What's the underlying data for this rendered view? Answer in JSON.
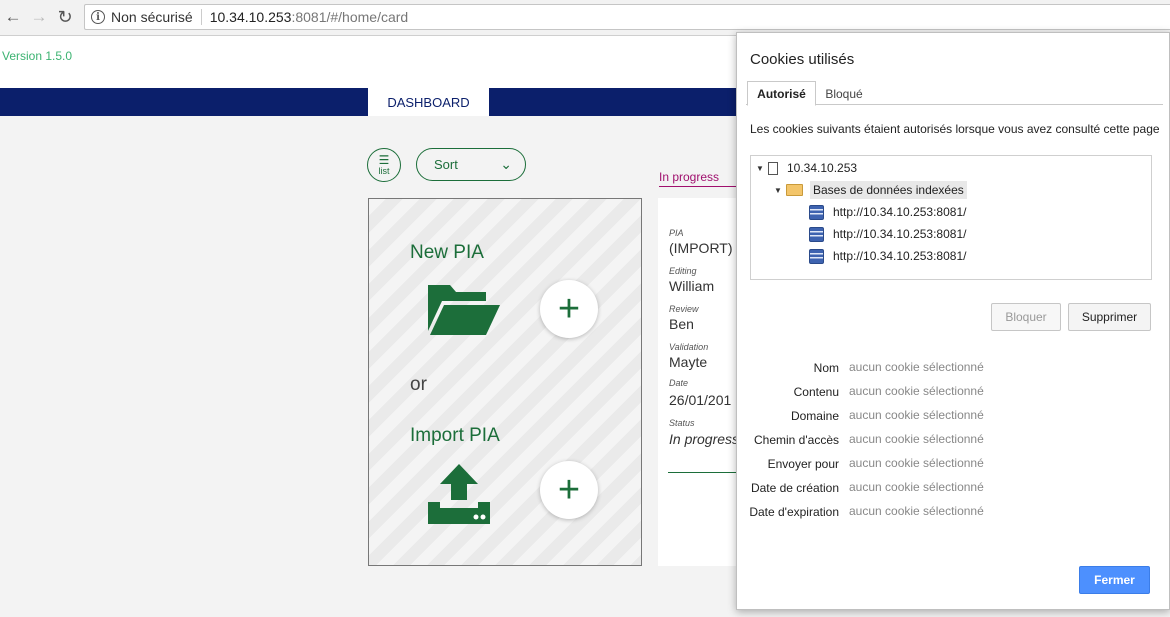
{
  "browser": {
    "security_label": "Non sécurisé",
    "url_host": "10.34.10.253",
    "url_rest": ":8081/#/home/card"
  },
  "app": {
    "version": "Version 1.5.0",
    "nav_tab": "DASHBOARD",
    "list_button": "list",
    "sort_label": "Sort",
    "new_pia": "New PIA",
    "or": "or",
    "import_pia": "Import PIA",
    "status_title": "In progress",
    "pia_card": {
      "pia_label": "PIA",
      "pia_value": "(IMPORT) T",
      "editing_label": "Editing",
      "editing_value": "William",
      "review_label": "Review",
      "review_value": "Ben",
      "validation_label": "Validation",
      "validation_value": "Mayte",
      "date_label": "Date",
      "date_value": "26/01/201",
      "status_label": "Status",
      "status_value": "In progress"
    },
    "colors": {
      "navbar": "#0b1f6b",
      "accent": "#1c6e3a",
      "status": "#a0106e"
    }
  },
  "dialog": {
    "title": "Cookies utilisés",
    "tabs": [
      "Autorisé",
      "Bloqué"
    ],
    "intro": "Les cookies suivants étaient autorisés lorsque vous avez consulté cette page",
    "tree": {
      "site": "10.34.10.253",
      "folder": "Bases de données indexées",
      "entries": [
        "http://10.34.10.253:8081/",
        "http://10.34.10.253:8081/",
        "http://10.34.10.253:8081/"
      ]
    },
    "block_button": "Bloquer",
    "delete_button": "Supprimer",
    "properties": [
      {
        "label": "Nom",
        "value": "aucun cookie sélectionné"
      },
      {
        "label": "Contenu",
        "value": "aucun cookie sélectionné"
      },
      {
        "label": "Domaine",
        "value": "aucun cookie sélectionné"
      },
      {
        "label": "Chemin d'accès",
        "value": "aucun cookie sélectionné"
      },
      {
        "label": "Envoyer pour",
        "value": "aucun cookie sélectionné"
      },
      {
        "label": "Date de création",
        "value": "aucun cookie sélectionné"
      },
      {
        "label": "Date d'expiration",
        "value": "aucun cookie sélectionné"
      }
    ],
    "close_button": "Fermer"
  }
}
